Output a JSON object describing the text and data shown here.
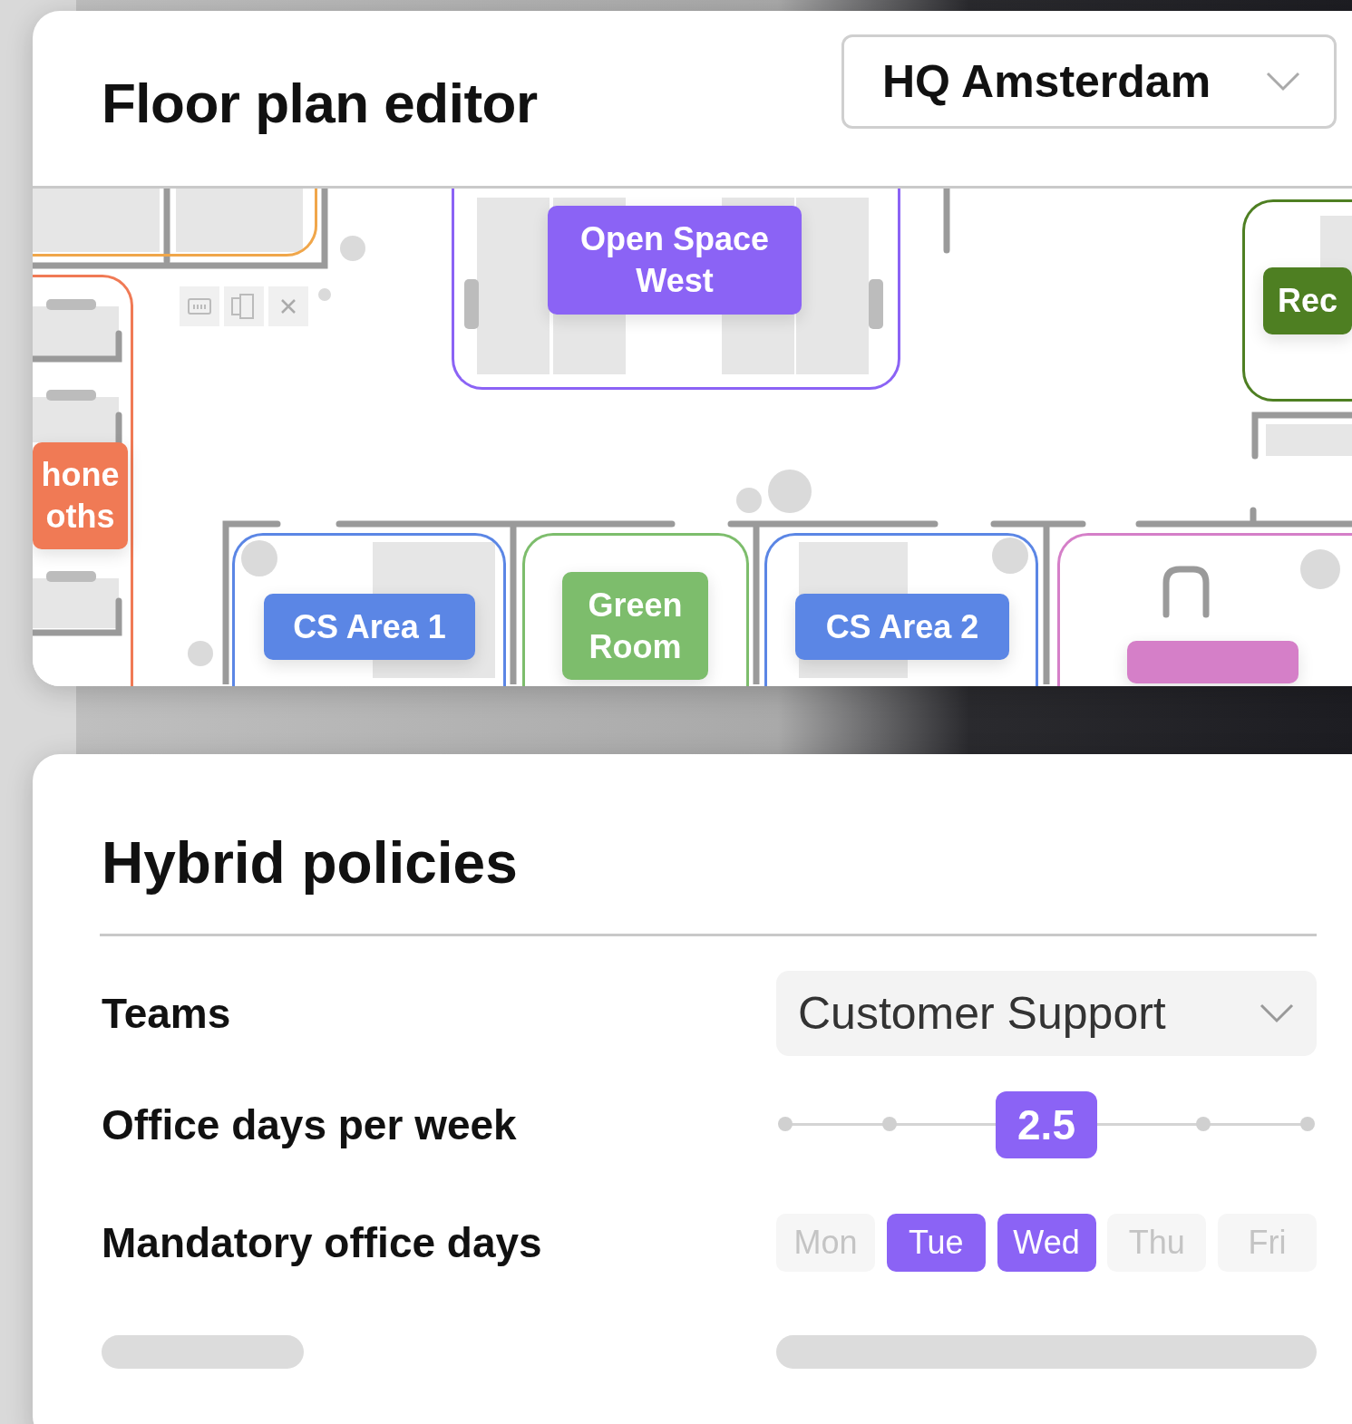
{
  "floor_plan": {
    "title": "Floor plan editor",
    "location": "HQ Amsterdam",
    "zones": [
      {
        "color": "#f0a64a"
      },
      {
        "label": "hone\noths",
        "color": "#f07a55"
      },
      {
        "label": "Open Space\nWest",
        "color": "#8b63f5"
      },
      {
        "label": "Rec",
        "color": "#4e7f22"
      },
      {
        "label": "CS Area 1",
        "color": "#5b86e5"
      },
      {
        "label": "Green\nRoom",
        "color": "#7dbd6c"
      },
      {
        "label": "CS Area 2",
        "color": "#5b86e5"
      },
      {
        "color": "#d57fc8"
      }
    ]
  },
  "hybrid_policies": {
    "title": "Hybrid policies",
    "teams": {
      "label": "Teams",
      "value": "Customer Support"
    },
    "office_days": {
      "label": "Office days per week",
      "value": "2.5",
      "level": 0.5
    },
    "mandatory_days": {
      "label": "Mandatory office days",
      "days": [
        {
          "label": "Mon",
          "selected": false
        },
        {
          "label": "Tue",
          "selected": true
        },
        {
          "label": "Wed",
          "selected": true
        },
        {
          "label": "Thu",
          "selected": false
        },
        {
          "label": "Fri",
          "selected": false
        }
      ]
    }
  }
}
